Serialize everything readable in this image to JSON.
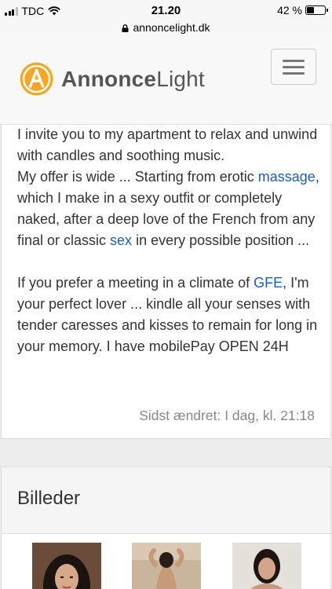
{
  "status_bar": {
    "carrier": "TDC",
    "time": "21.20",
    "battery_percent": "42 %",
    "battery_level": 0.42
  },
  "url_bar": {
    "url": "annoncelight.dk"
  },
  "header": {
    "logo_bold": "Annonce",
    "logo_light": "Light",
    "accent_color": "#f5a623"
  },
  "description": {
    "lines": [
      "I invite you to my apartment to relax and unwind with candles and soothing music.",
      "My offer is wide ... Starting from erotic ",
      "massage",
      ", which I make in a sexy outfit or completely naked, after a deep love of the French from any final or classic ",
      "sex",
      " in every possible position ..."
    ],
    "paragraph2_before": "If you prefer a meeting in a climate of ",
    "paragraph2_link": "GFE",
    "paragraph2_after": ", I'm your perfect lover ... kindle all your senses with tender caresses and kisses to remain for long in your memory. I have mobilePay OPEN 24H",
    "last_modified": "Sidst ændret: I dag, kl. 21:18"
  },
  "images": {
    "title": "Billeder"
  }
}
